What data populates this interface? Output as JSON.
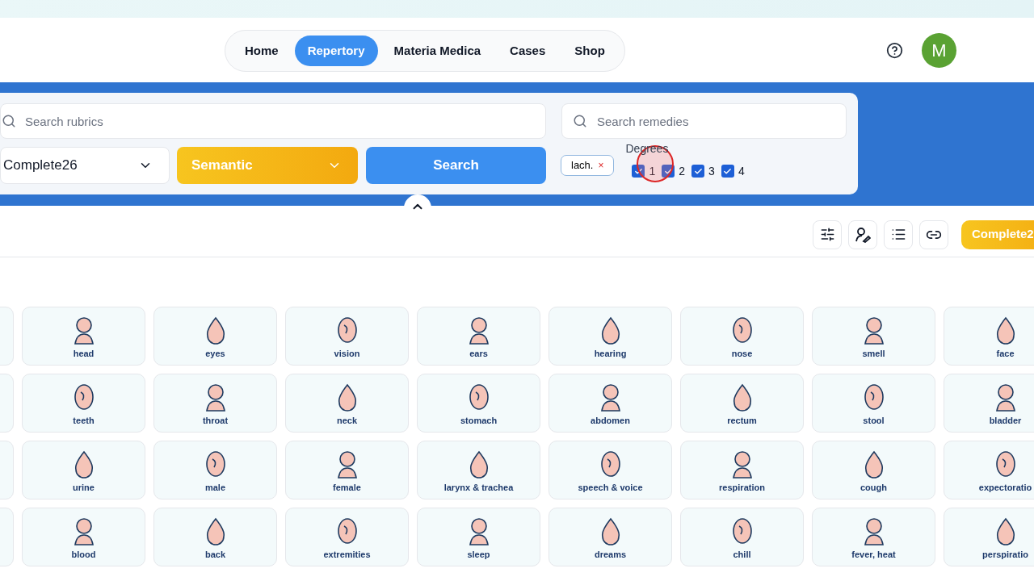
{
  "nav": {
    "tabs": [
      {
        "label": "Home",
        "selected": false
      },
      {
        "label": "Repertory",
        "selected": true
      },
      {
        "label": "Materia Medica",
        "selected": false
      },
      {
        "label": "Cases",
        "selected": false
      },
      {
        "label": "Shop",
        "selected": false
      }
    ],
    "avatar": "M"
  },
  "search": {
    "rubrics_placeholder": "Search rubrics",
    "remedies_placeholder": "Search remedies",
    "repertory": "Complete26",
    "mode": "Semantic",
    "button": "Search",
    "remedy_tags": [
      {
        "label": "lach.",
        "remove": "×"
      }
    ],
    "degrees_label": "Degrees",
    "degrees": [
      {
        "label": "1",
        "checked": true
      },
      {
        "label": "2",
        "checked": true
      },
      {
        "label": "3",
        "checked": true
      },
      {
        "label": "4",
        "checked": true
      }
    ]
  },
  "toolbar": {
    "repertory_badge": "Complete2"
  },
  "chapters": [
    [
      {
        "label": "head"
      },
      {
        "label": "eyes"
      },
      {
        "label": "vision"
      },
      {
        "label": "ears"
      },
      {
        "label": "hearing"
      },
      {
        "label": "nose"
      },
      {
        "label": "smell"
      },
      {
        "label": "face"
      }
    ],
    [
      {
        "label": "teeth"
      },
      {
        "label": "throat"
      },
      {
        "label": "neck"
      },
      {
        "label": "stomach"
      },
      {
        "label": "abdomen"
      },
      {
        "label": "rectum"
      },
      {
        "label": "stool"
      },
      {
        "label": "bladder"
      }
    ],
    [
      {
        "label": "urine"
      },
      {
        "label": "male"
      },
      {
        "label": "female"
      },
      {
        "label": "larynx & trachea"
      },
      {
        "label": "speech & voice"
      },
      {
        "label": "respiration"
      },
      {
        "label": "cough"
      },
      {
        "label": "expectoratio"
      }
    ],
    [
      {
        "label": "blood"
      },
      {
        "label": "back"
      },
      {
        "label": "extremities"
      },
      {
        "label": "sleep"
      },
      {
        "label": "dreams"
      },
      {
        "label": "chill"
      },
      {
        "label": "fever, heat"
      },
      {
        "label": "perspiratio"
      }
    ]
  ]
}
